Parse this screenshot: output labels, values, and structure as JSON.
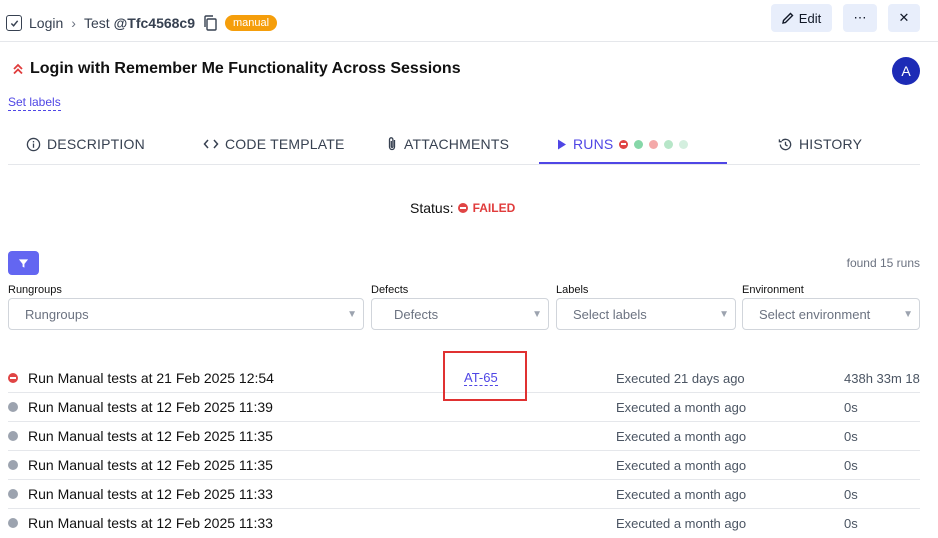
{
  "breadcrumb": {
    "suite": "Login",
    "test_prefix": "Test",
    "test_id": "@Tfc4568c9",
    "badge": "manual"
  },
  "header_buttons": {
    "edit": "Edit",
    "more": "⋯",
    "close": "✕"
  },
  "test": {
    "title": "Login with Remember Me Functionality Across Sessions",
    "avatar": "A",
    "set_labels": "Set labels"
  },
  "tabs": [
    {
      "label": "DESCRIPTION",
      "icon": "info-icon"
    },
    {
      "label": "CODE TEMPLATE",
      "icon": "code-icon"
    },
    {
      "label": "ATTACHMENTS",
      "icon": "paperclip-icon"
    },
    {
      "label": "RUNS",
      "icon": "play-icon"
    },
    {
      "label": "HISTORY",
      "icon": "history-icon"
    }
  ],
  "runs_tab_dots": [
    "#e04545",
    "#86d7a8",
    "#f4a9a9",
    "#b7e6c8",
    "#d4efdf"
  ],
  "status": {
    "label": "Status:",
    "value": "FAILED"
  },
  "found": "found 15 runs",
  "filters": [
    {
      "label": "Rungroups",
      "placeholder": "Rungroups"
    },
    {
      "label": "Defects",
      "placeholder": "Defects"
    },
    {
      "label": "Labels",
      "placeholder": "Select labels"
    },
    {
      "label": "Environment",
      "placeholder": "Select environment"
    }
  ],
  "colors": {
    "accent": "#4f46e5",
    "failed": "#e04545",
    "neutral": "#9ca3af",
    "badge": "#f59e0b"
  },
  "runs": [
    {
      "title": "Run Manual tests at 21 Feb 2025 12:54",
      "status": "failed",
      "link": "AT-65",
      "executed": "Executed 21 days ago",
      "duration": "438h 33m 18"
    },
    {
      "title": "Run Manual tests at 12 Feb 2025 11:39",
      "status": "neutral",
      "link": "",
      "executed": "Executed a month ago",
      "duration": "0s"
    },
    {
      "title": "Run Manual tests at 12 Feb 2025 11:35",
      "status": "neutral",
      "link": "",
      "executed": "Executed a month ago",
      "duration": "0s"
    },
    {
      "title": "Run Manual tests at 12 Feb 2025 11:35",
      "status": "neutral",
      "link": "",
      "executed": "Executed a month ago",
      "duration": "0s"
    },
    {
      "title": "Run Manual tests at 12 Feb 2025 11:33",
      "status": "neutral",
      "link": "",
      "executed": "Executed a month ago",
      "duration": "0s"
    },
    {
      "title": "Run Manual tests at 12 Feb 2025 11:33",
      "status": "neutral",
      "link": "",
      "executed": "Executed a month ago",
      "duration": "0s"
    }
  ]
}
